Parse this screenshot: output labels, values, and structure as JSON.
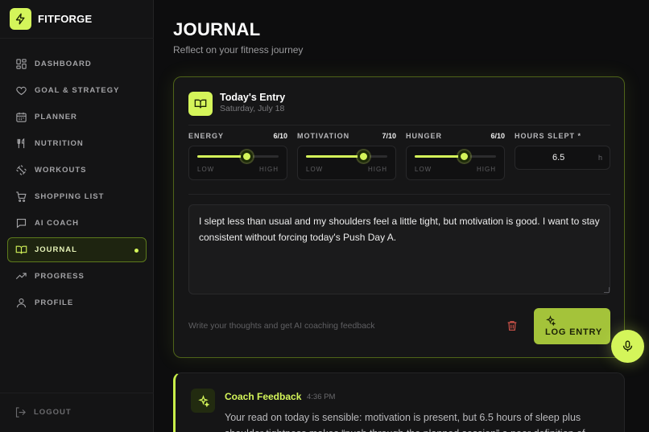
{
  "brand": {
    "name": "FITFORGE",
    "icon": "lightning-icon"
  },
  "sidebar": {
    "items": [
      {
        "label": "DASHBOARD",
        "icon": "dashboard-icon"
      },
      {
        "label": "GOAL & STRATEGY",
        "icon": "heart-icon"
      },
      {
        "label": "PLANNER",
        "icon": "calendar-icon"
      },
      {
        "label": "NUTRITION",
        "icon": "utensils-icon"
      },
      {
        "label": "WORKOUTS",
        "icon": "dumbbell-icon"
      },
      {
        "label": "SHOPPING LIST",
        "icon": "cart-icon"
      },
      {
        "label": "AI COACH",
        "icon": "chat-icon"
      },
      {
        "label": "JOURNAL",
        "icon": "book-icon",
        "active": true
      },
      {
        "label": "PROGRESS",
        "icon": "trend-icon"
      },
      {
        "label": "PROFILE",
        "icon": "user-icon"
      }
    ],
    "logout": "LOGOUT"
  },
  "page": {
    "title": "JOURNAL",
    "subtitle": "Reflect on your fitness journey"
  },
  "entry": {
    "title": "Today's Entry",
    "date": "Saturday, July 18",
    "metrics": [
      {
        "label": "ENERGY",
        "value_text": "6/10",
        "value": 6,
        "max": 10,
        "low": "LOW",
        "high": "HIGH"
      },
      {
        "label": "MOTIVATION",
        "value_text": "7/10",
        "value": 7,
        "max": 10,
        "low": "LOW",
        "high": "HIGH"
      },
      {
        "label": "HUNGER",
        "value_text": "6/10",
        "value": 6,
        "max": 10,
        "low": "LOW",
        "high": "HIGH"
      }
    ],
    "sleep": {
      "label": "HOURS SLEPT *",
      "value": "6.5",
      "unit": "h"
    },
    "text": "I slept less than usual and my shoulders feel a little tight, but motivation is good. I want to stay consistent without forcing today's Push Day A.",
    "hint": "Write your thoughts and get AI coaching feedback",
    "log_button": "LOG ENTRY"
  },
  "feedback": {
    "title": "Coach Feedback",
    "time": "4:36 PM",
    "text": "Your read on today is sensible: motivation is present, but 6.5 hours of sleep plus shoulder tightness makes “push through the planned session” a poor definition of"
  },
  "colors": {
    "accent": "#d4f55a",
    "background": "#0d0d0e",
    "sidebar": "#141415",
    "card": "#161617"
  }
}
